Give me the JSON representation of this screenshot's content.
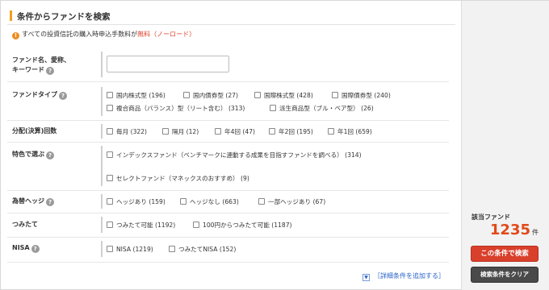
{
  "header": {
    "title": "条件からファンドを検索"
  },
  "notice": {
    "text": "すべての投資信託の購入時申込手数料が",
    "free": "無料（ノーロード）"
  },
  "fund_name": {
    "label_line1": "ファンド名、愛称、",
    "label_line2": "キーワード",
    "value": "",
    "placeholder": ""
  },
  "fund_type": {
    "label": "ファンドタイプ",
    "options": [
      "国内株式型 (196)",
      "国内債券型 (27)",
      "国際株式型 (428)",
      "国際債券型 (240)",
      "複合商品（バランス）型（リート含む） (313)",
      "派生商品型（ブル・ベア型） (26)"
    ]
  },
  "distribution": {
    "label": "分配(決算)回数",
    "options": [
      "毎月 (322)",
      "隔月 (12)",
      "年4回 (47)",
      "年2回 (195)",
      "年1回 (659)"
    ]
  },
  "feature": {
    "label": "特色で選ぶ",
    "options": [
      "インデックスファンド（ベンチマークに連動する成果を目指すファンドを調べる） (314)",
      "セレクトファンド（マネックスのおすすめ） (9)"
    ]
  },
  "hedge": {
    "label": "為替ヘッジ",
    "options": [
      "ヘッジあり (159)",
      "ヘッジなし (663)",
      "一部ヘッジあり (67)"
    ]
  },
  "tsumitate": {
    "label": "つみたて",
    "options": [
      "つみたて可能 (1192)",
      "100円からつみたて可能 (1187)"
    ]
  },
  "nisa": {
    "label": "NISA",
    "options": [
      "NISA (1219)",
      "つみたてNISA (152)"
    ]
  },
  "more_link": {
    "icon": "▼",
    "text": "［詳細条件を追加する］"
  },
  "side": {
    "count_label": "該当ファンド",
    "count": "1235",
    "count_unit": "件",
    "search_button": "この条件で検索",
    "clear_button": "検索条件をクリア"
  },
  "icons": {
    "help": "?",
    "info": "!"
  },
  "colors": {
    "accent": "#f0a020",
    "free": "#e0402a",
    "count": "#e04a1a",
    "search_button": "#d9402c",
    "clear_button": "#4a4a4a",
    "link": "#2a63c8"
  }
}
